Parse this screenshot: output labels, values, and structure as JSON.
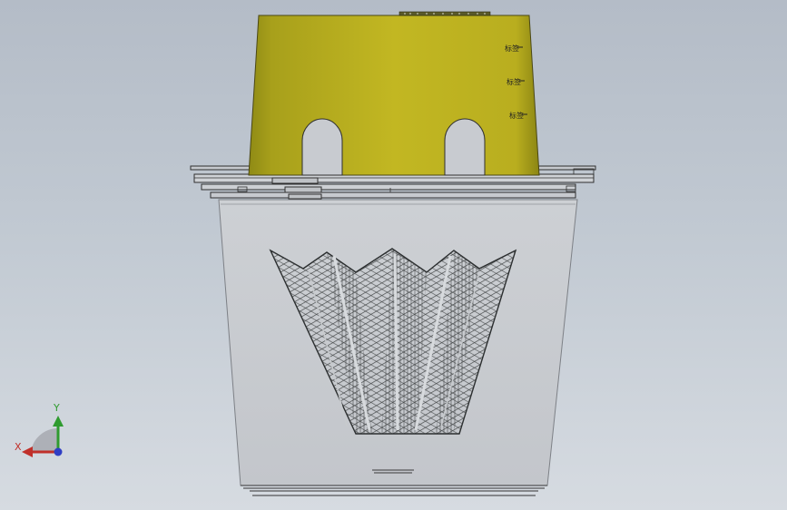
{
  "colors": {
    "background_top": "#b4bcc7",
    "background_bottom": "#d6dbe1",
    "part_body": "#c2b422",
    "part_shadow": "#908a15",
    "lower_housing": "#c9ccd1",
    "wire_dark": "#3f4243",
    "outline": "#2a2a2a",
    "axis_x": "#c0302a",
    "axis_y": "#2f9b2f",
    "axis_z": "#2f3ec4"
  },
  "viewport": {
    "tick_marks": [
      "标签",
      "标签",
      "标签"
    ]
  },
  "triad": {
    "x_label": "X",
    "y_label": "Y"
  }
}
